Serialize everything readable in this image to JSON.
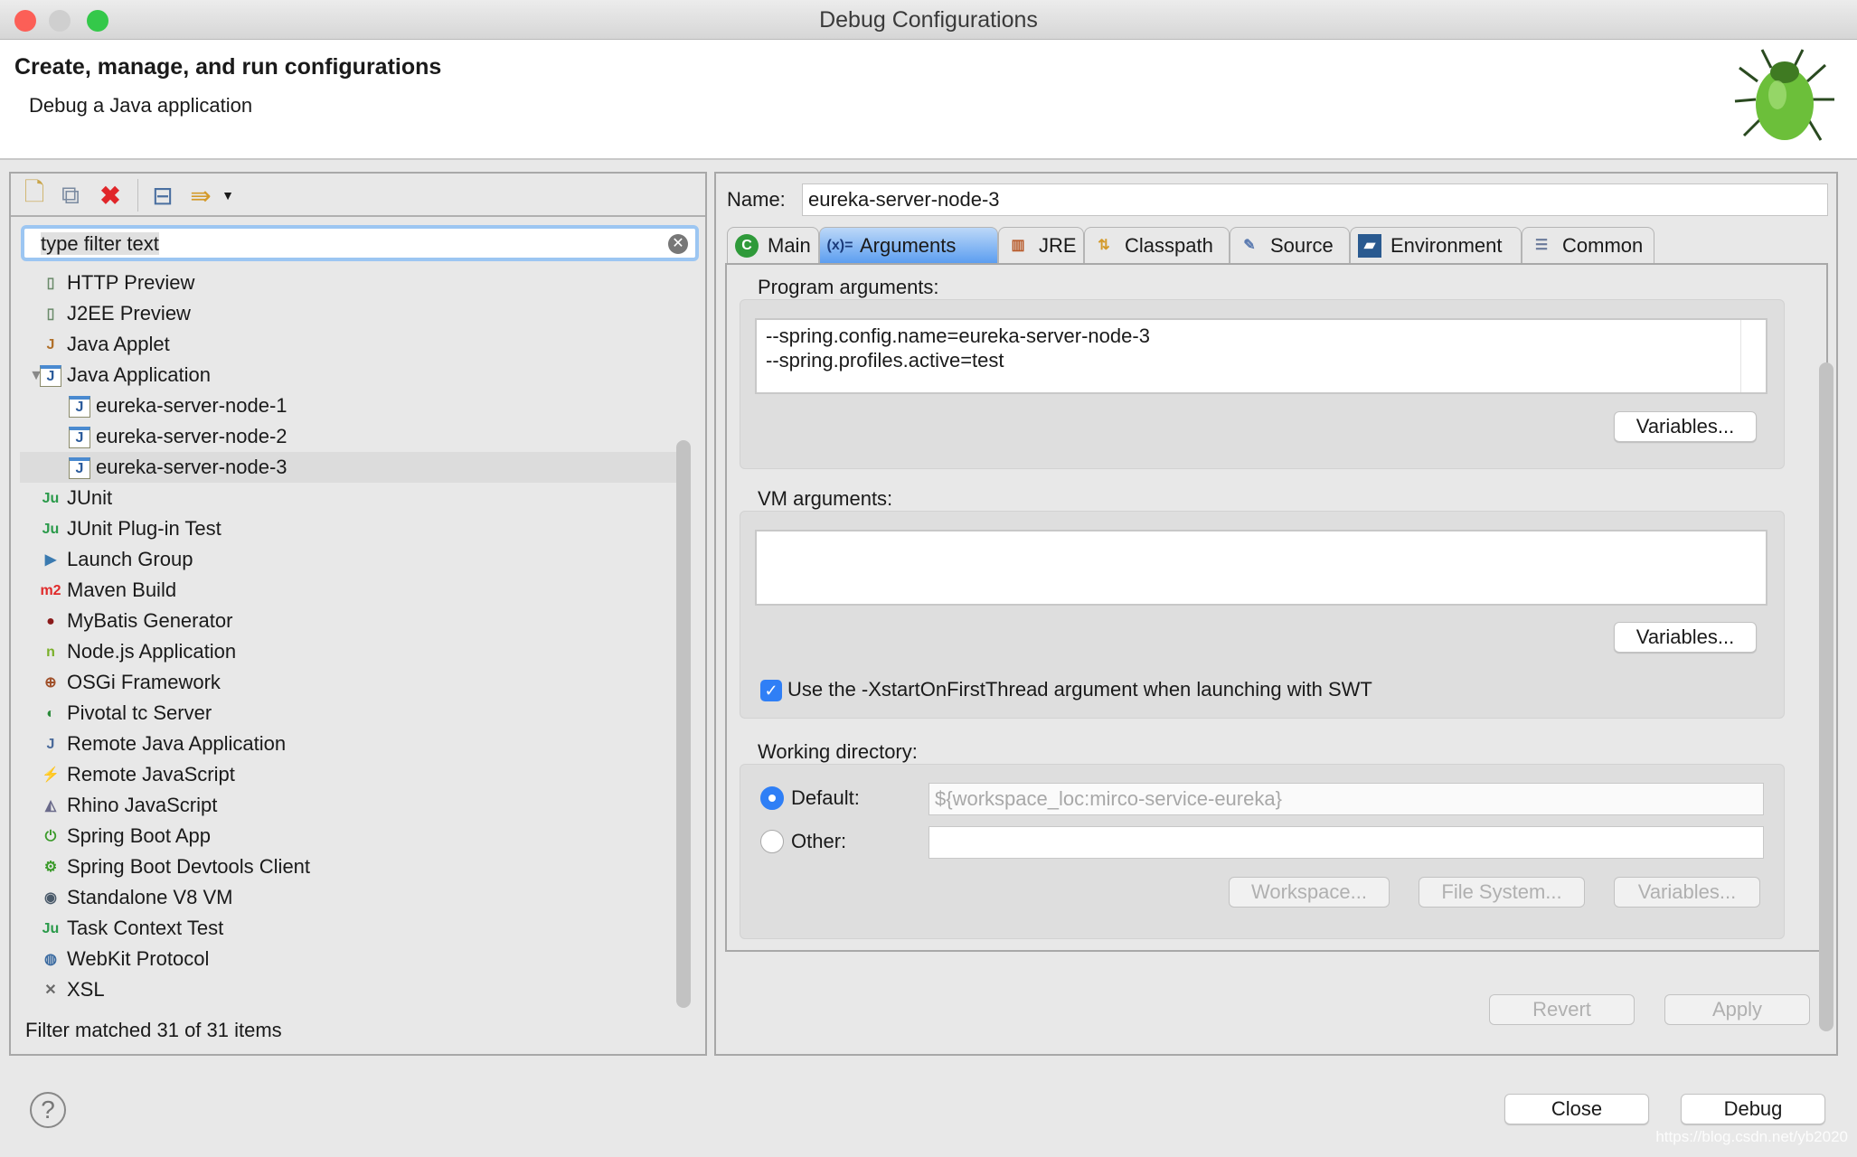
{
  "window": {
    "title": "Debug Configurations"
  },
  "header": {
    "title": "Create, manage, and run configurations",
    "subtitle": "Debug a Java application"
  },
  "left": {
    "toolbar": [
      "new-configuration-icon",
      "duplicate-icon",
      "delete-icon",
      "collapse-all-icon",
      "filter-icon"
    ],
    "filter": {
      "value": "type filter text"
    },
    "tree": [
      {
        "label": "HTTP Preview",
        "icon": "server-icon",
        "level": 0
      },
      {
        "label": "J2EE Preview",
        "icon": "server-icon",
        "level": 0
      },
      {
        "label": "Java Applet",
        "icon": "java-applet-icon",
        "level": 0
      },
      {
        "label": "Java Application",
        "icon": "java-app-icon",
        "level": 0,
        "expanded": true
      },
      {
        "label": "eureka-server-node-1",
        "icon": "java-app-icon",
        "level": 1
      },
      {
        "label": "eureka-server-node-2",
        "icon": "java-app-icon",
        "level": 1
      },
      {
        "label": "eureka-server-node-3",
        "icon": "java-app-icon",
        "level": 1,
        "selected": true
      },
      {
        "label": "JUnit",
        "icon": "junit-icon",
        "level": 0
      },
      {
        "label": "JUnit Plug-in Test",
        "icon": "junit-plugin-icon",
        "level": 0
      },
      {
        "label": "Launch Group",
        "icon": "launch-group-icon",
        "level": 0
      },
      {
        "label": "Maven Build",
        "icon": "maven-icon",
        "level": 0
      },
      {
        "label": "MyBatis Generator",
        "icon": "mybatis-icon",
        "level": 0
      },
      {
        "label": "Node.js Application",
        "icon": "nodejs-icon",
        "level": 0
      },
      {
        "label": "OSGi Framework",
        "icon": "osgi-icon",
        "level": 0
      },
      {
        "label": "Pivotal tc Server",
        "icon": "pivotal-icon",
        "level": 0
      },
      {
        "label": "Remote Java Application",
        "icon": "remote-java-icon",
        "level": 0
      },
      {
        "label": "Remote JavaScript",
        "icon": "remote-js-icon",
        "level": 0
      },
      {
        "label": "Rhino JavaScript",
        "icon": "rhino-icon",
        "level": 0
      },
      {
        "label": "Spring Boot App",
        "icon": "spring-boot-icon",
        "level": 0
      },
      {
        "label": "Spring Boot Devtools Client",
        "icon": "spring-devtools-icon",
        "level": 0
      },
      {
        "label": "Standalone V8 VM",
        "icon": "v8-icon",
        "level": 0
      },
      {
        "label": "Task Context Test",
        "icon": "junit-icon",
        "level": 0
      },
      {
        "label": "WebKit Protocol",
        "icon": "webkit-icon",
        "level": 0
      },
      {
        "label": "XSL",
        "icon": "xsl-icon",
        "level": 0
      }
    ],
    "status": "Filter matched 31 of 31 items"
  },
  "right": {
    "name_label": "Name:",
    "name_value": "eureka-server-node-3",
    "tabs": [
      {
        "label": "Main",
        "icon": "main-icon"
      },
      {
        "label": "Arguments",
        "icon": "arguments-icon",
        "active": true
      },
      {
        "label": "JRE",
        "icon": "jre-icon"
      },
      {
        "label": "Classpath",
        "icon": "classpath-icon"
      },
      {
        "label": "Source",
        "icon": "source-icon"
      },
      {
        "label": "Environment",
        "icon": "environment-icon"
      },
      {
        "label": "Common",
        "icon": "common-icon"
      }
    ],
    "program_args": {
      "label": "Program arguments:",
      "lines": [
        "--spring.config.name=eureka-server-node-3",
        "--spring.profiles.active=test"
      ],
      "variables": "Variables..."
    },
    "vm_args": {
      "label": "VM arguments:",
      "value": "",
      "variables": "Variables..."
    },
    "xstart": {
      "label": "Use the -XstartOnFirstThread argument when launching with SWT",
      "checked": true
    },
    "workdir": {
      "label": "Working directory:",
      "default_label": "Default:",
      "default_value": "${workspace_loc:mirco-service-eureka}",
      "default_selected": true,
      "other_label": "Other:",
      "other_value": "",
      "workspace": "Workspace...",
      "filesystem": "File System...",
      "variables": "Variables..."
    },
    "revert": "Revert",
    "apply": "Apply"
  },
  "footer": {
    "close": "Close",
    "debug": "Debug",
    "help": "?"
  },
  "watermark": "https://blog.csdn.net/yb2020",
  "colors": {
    "accent": "#2f7ff6",
    "selection": "#dcdcdc",
    "filter_focus": "#9cc6f2"
  }
}
